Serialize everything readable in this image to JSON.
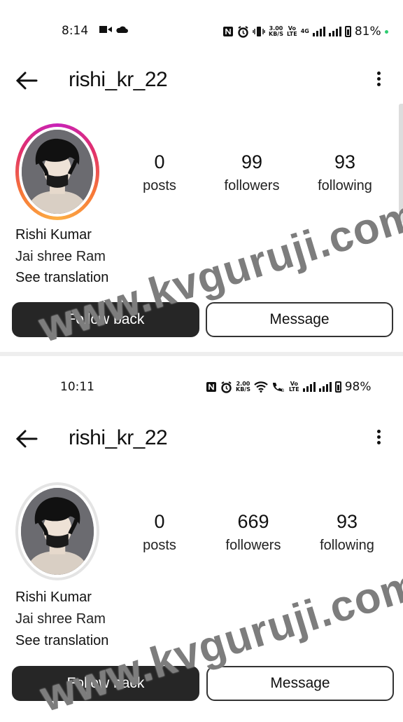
{
  "screens": [
    {
      "status": {
        "time": "8:14",
        "speed": "3.00\nKB/S",
        "volte": "Vo\nLTE",
        "net": "4G",
        "battery": "81%"
      },
      "header": {
        "username": "rishi_kr_22"
      },
      "stats": {
        "posts_num": "0",
        "posts_label": "posts",
        "followers_num": "99",
        "followers_label": "followers",
        "following_num": "93",
        "following_label": "following"
      },
      "profile": {
        "name": "Rishi Kumar",
        "bio": "Jai shree Ram",
        "translate": "See translation"
      },
      "actions": {
        "follow_back": "Follow back",
        "message": "Message"
      },
      "watermark": "www.kvguruji.com"
    },
    {
      "status": {
        "time": "10:11",
        "speed": "2.00\nKB/S",
        "volte": "Vo\nLTE",
        "battery": "98%"
      },
      "header": {
        "username": "rishi_kr_22"
      },
      "stats": {
        "posts_num": "0",
        "posts_label": "posts",
        "followers_num": "669",
        "followers_label": "followers",
        "following_num": "93",
        "following_label": "following"
      },
      "profile": {
        "name": "Rishi Kumar",
        "bio": "Jai shree Ram",
        "translate": "See translation"
      },
      "actions": {
        "follow_back": "Follow back",
        "message": "Message"
      },
      "watermark": "www.kvguruji.com"
    }
  ],
  "colors": {
    "dark_button": "#262626",
    "story_ring_start": "#c822b8",
    "story_ring_end": "#fcaf45",
    "watermark": "#7d7d7d"
  },
  "icons": [
    "back-arrow-icon",
    "more-options-icon",
    "nfc-icon",
    "alarm-icon",
    "vibrate-icon",
    "wifi-icon",
    "call-icon",
    "signal-icon",
    "battery-icon",
    "video-icon",
    "cloud-icon"
  ]
}
